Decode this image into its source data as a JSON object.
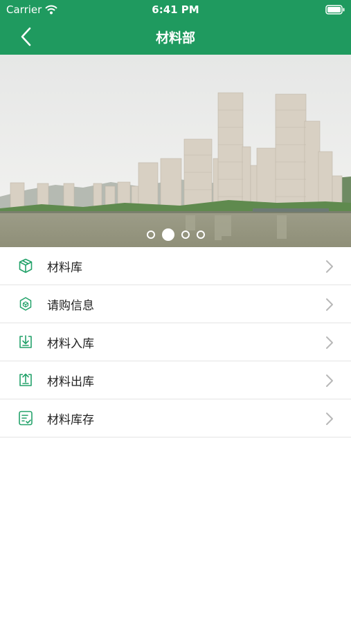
{
  "status": {
    "carrier": "Carrier",
    "time": "6:41 PM"
  },
  "nav": {
    "title": "材料部"
  },
  "banner": {
    "slide_count": 4,
    "active_slide": 2
  },
  "menu": [
    {
      "label": "材料库",
      "icon": "package-icon"
    },
    {
      "label": "请购信息",
      "icon": "purchase-request-icon"
    },
    {
      "label": "材料入库",
      "icon": "inbound-icon"
    },
    {
      "label": "材料出库",
      "icon": "outbound-icon"
    },
    {
      "label": "材料库存",
      "icon": "inventory-icon"
    }
  ],
  "colors": {
    "primary": "#1f9a5f",
    "icon": "#23a26a",
    "chevron": "#b8b8b8"
  }
}
